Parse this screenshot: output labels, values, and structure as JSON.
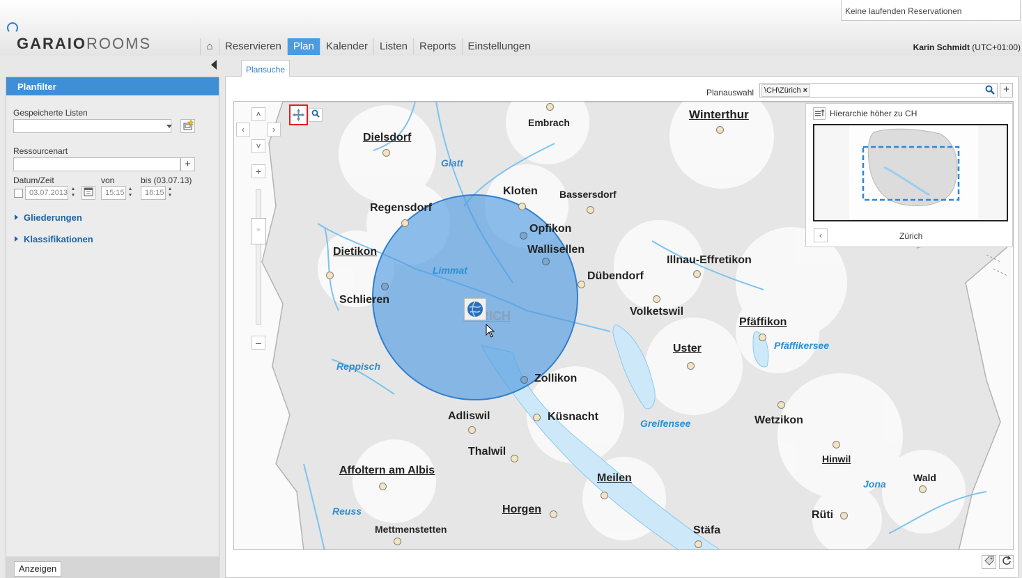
{
  "header": {
    "status": "Keine laufenden Reservationen",
    "logo_bold": "GARAIO",
    "logo_light": "ROOMS",
    "user_name": "Karin Schmidt",
    "user_tz": "(UTC+01:00)",
    "nav": [
      {
        "label": "Reservieren"
      },
      {
        "label": "Plan"
      },
      {
        "label": "Kalender"
      },
      {
        "label": "Listen"
      },
      {
        "label": "Reports"
      },
      {
        "label": "Einstellungen"
      }
    ]
  },
  "sidebar": {
    "title": "Planfilter",
    "saved_lists_label": "Gespeicherte Listen",
    "resource_type_label": "Ressourcenart",
    "datetime_label": "Datum/Zeit",
    "from_label": "von",
    "to_label": "bis (03.07.13)",
    "date_value": "03.07.2013",
    "from_value": "15:15",
    "to_value": "16:15",
    "sections": [
      {
        "label": "Gliederungen"
      },
      {
        "label": "Klassifikationen"
      }
    ],
    "show_button": "Anzeigen"
  },
  "main": {
    "tab": "Plansuche",
    "plan_selection_label": "Planauswahl",
    "plan_chip": "\\CH\\Zürich",
    "plan_chip_remove": "×"
  },
  "map": {
    "overview_title": "Hierarchie höher zu CH",
    "overview_current": "Zürich",
    "selection_color": "#4a97e0",
    "cities": [
      {
        "name": "Embrach"
      },
      {
        "name": "Winterthur"
      },
      {
        "name": "Dielsdorf"
      },
      {
        "name": "Kloten"
      },
      {
        "name": "Bassersdorf"
      },
      {
        "name": "Regensdorf"
      },
      {
        "name": "Opfikon"
      },
      {
        "name": "Wallisellen"
      },
      {
        "name": "Dietikon"
      },
      {
        "name": "Illnau-Effretikon"
      },
      {
        "name": "Dübendorf"
      },
      {
        "name": "Schlieren"
      },
      {
        "name": "ZÜRICH"
      },
      {
        "name": "Volketswil"
      },
      {
        "name": "Pfäffikon"
      },
      {
        "name": "Uster"
      },
      {
        "name": "Zollikon"
      },
      {
        "name": "Adliswil"
      },
      {
        "name": "Küsnacht"
      },
      {
        "name": "Wetzikon"
      },
      {
        "name": "Thalwil"
      },
      {
        "name": "Hinwil"
      },
      {
        "name": "Affoltern am Albis"
      },
      {
        "name": "Meilen"
      },
      {
        "name": "Wald"
      },
      {
        "name": "Horgen"
      },
      {
        "name": "Rüti"
      },
      {
        "name": "Mettmenstetten"
      },
      {
        "name": "Stäfa"
      }
    ],
    "waters": [
      {
        "name": "Glatt"
      },
      {
        "name": "Limmat"
      },
      {
        "name": "Reppisch"
      },
      {
        "name": "Pfäffikersee"
      },
      {
        "name": "Greifensee"
      },
      {
        "name": "Jona"
      },
      {
        "name": "Reuss"
      }
    ]
  }
}
